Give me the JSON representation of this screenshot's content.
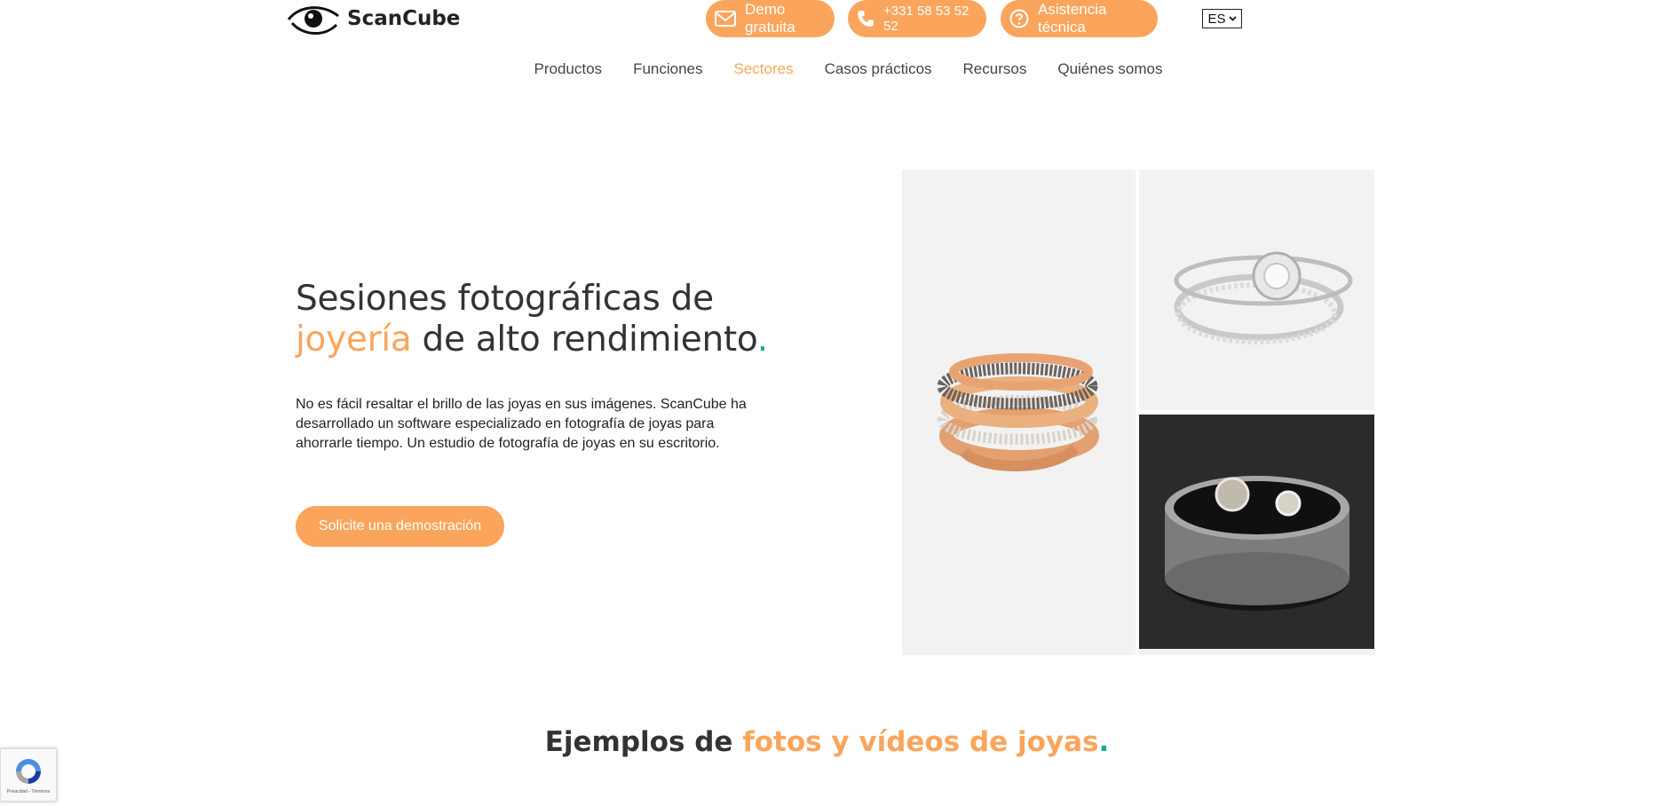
{
  "header": {
    "brand": "ScanCube",
    "buttons": {
      "demo": "Demo gratuita",
      "phone": "+331 58 53 52 52",
      "support": "Asistencia técnica"
    },
    "language": "ES"
  },
  "nav": {
    "items": [
      {
        "label": "Productos"
      },
      {
        "label": "Funciones"
      },
      {
        "label": "Sectores",
        "active": true
      },
      {
        "label": "Casos prácticos"
      },
      {
        "label": "Recursos"
      },
      {
        "label": "Quiénes somos"
      }
    ]
  },
  "hero": {
    "title_line1": "Sesiones fotográficas de",
    "title_accent": "joyería",
    "title_rest": " de alto rendimiento",
    "title_dot": ".",
    "description": "No es fácil resaltar el brillo de las joyas en sus imágenes. ScanCube ha desarrollado un software especializado en fotografía de joyas para ahorrarle tiempo. Un estudio de fotografía de joyas en su escritorio.",
    "cta": "Solicite una demostración"
  },
  "section2": {
    "title_start": "Ejemplos de ",
    "title_accent": "fotos y vídeos de joyas",
    "title_dot": "."
  },
  "recaptcha": {
    "text": "Privacidad - Términos"
  },
  "colors": {
    "accent": "#fba55c",
    "teal": "#1aa79c",
    "text": "#333333"
  },
  "icons": [
    "eye-logo-icon",
    "envelope-icon",
    "phone-icon",
    "question-icon",
    "chevron-down-icon",
    "recaptcha-icon"
  ]
}
